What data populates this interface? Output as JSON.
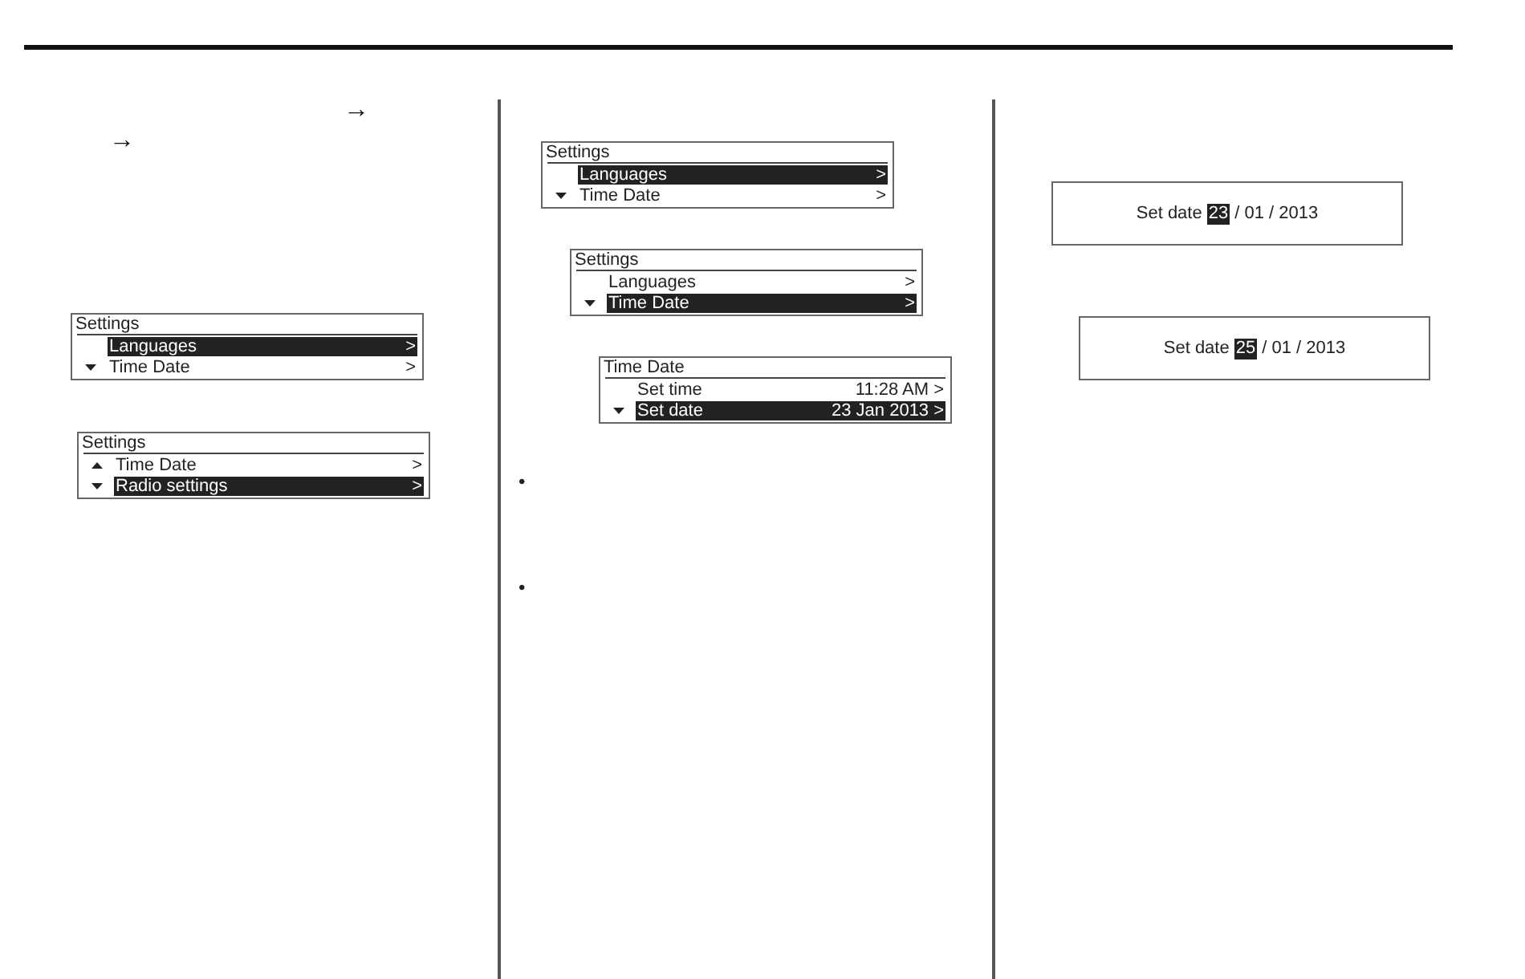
{
  "columns": [
    {
      "blocks": [
        {
          "kind": "symbol",
          "text": "→"
        },
        {
          "kind": "symbol",
          "text": "→"
        },
        {
          "kind": "menu_screen",
          "title": "Settings",
          "rows": [
            {
              "label": "Languages",
              "chevron": ">",
              "selected": true,
              "scroll_up": false,
              "scroll_down": false
            },
            {
              "label": "Time Date",
              "chevron": ">",
              "selected": false,
              "scroll_up": false,
              "scroll_down": true
            }
          ]
        },
        {
          "kind": "menu_screen",
          "title": "Settings",
          "rows": [
            {
              "label": "Time Date",
              "chevron": ">",
              "selected": false,
              "scroll_up": true,
              "scroll_down": false
            },
            {
              "label": "Radio settings",
              "chevron": ">",
              "selected": true,
              "scroll_up": false,
              "scroll_down": true
            }
          ]
        }
      ]
    },
    {
      "blocks": [
        {
          "kind": "menu_screen",
          "title": "Settings",
          "rows": [
            {
              "label": "Languages",
              "chevron": ">",
              "selected": true,
              "scroll_up": false,
              "scroll_down": false
            },
            {
              "label": "Time Date",
              "chevron": ">",
              "selected": false,
              "scroll_up": false,
              "scroll_down": true
            }
          ]
        },
        {
          "kind": "menu_screen",
          "title": "Settings",
          "rows": [
            {
              "label": "Languages",
              "chevron": ">",
              "selected": false,
              "scroll_up": false,
              "scroll_down": false
            },
            {
              "label": "Time Date",
              "chevron": ">",
              "selected": true,
              "scroll_up": false,
              "scroll_down": true
            }
          ]
        },
        {
          "kind": "menu_screen",
          "title": "Time Date",
          "rows": [
            {
              "label": "Set time",
              "value": "11:28 AM",
              "chevron": ">",
              "selected": false,
              "scroll_up": false,
              "scroll_down": false
            },
            {
              "label": "Set date",
              "value": "23 Jan 2013",
              "chevron": ">",
              "selected": true,
              "scroll_up": false,
              "scroll_down": true
            }
          ]
        },
        {
          "kind": "bullet",
          "text": "•"
        },
        {
          "kind": "bullet",
          "text": "•"
        }
      ]
    },
    {
      "blocks": [
        {
          "kind": "date_screen",
          "label": "Set date",
          "parts": [
            {
              "text": "23",
              "selected": true
            },
            {
              "text": "/ 01 / 2013",
              "selected": false
            }
          ]
        },
        {
          "kind": "date_screen",
          "label": "Set date",
          "parts": [
            {
              "text": "25",
              "selected": true
            },
            {
              "text": "/ 01 / 2013",
              "selected": false
            }
          ]
        }
      ]
    }
  ]
}
